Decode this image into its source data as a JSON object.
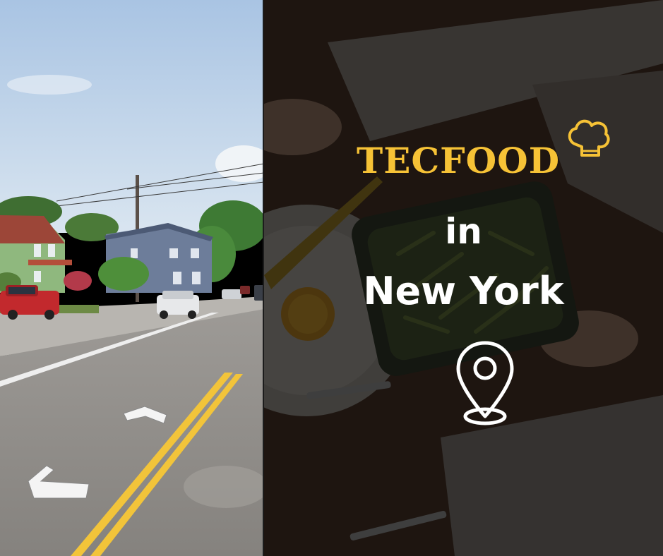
{
  "brand": {
    "name": "TECFOOD",
    "color": "#f6c236",
    "icon": "chef-hat-icon"
  },
  "tagline": {
    "line1": "in",
    "line2": "New York"
  },
  "location_icon": "location-pin-icon",
  "left_photo": {
    "subject": "street-view-residential-street",
    "controls": [
      "nav-arrow-left-icon",
      "nav-arrow-forward-icon"
    ]
  },
  "right_photo": {
    "subject": "overhead-dining-table-darkened"
  },
  "colors": {
    "sky": "#b9cfe6",
    "road": "#8f8c88",
    "lane_line": "#f2c43a",
    "overlay": "#000000"
  }
}
